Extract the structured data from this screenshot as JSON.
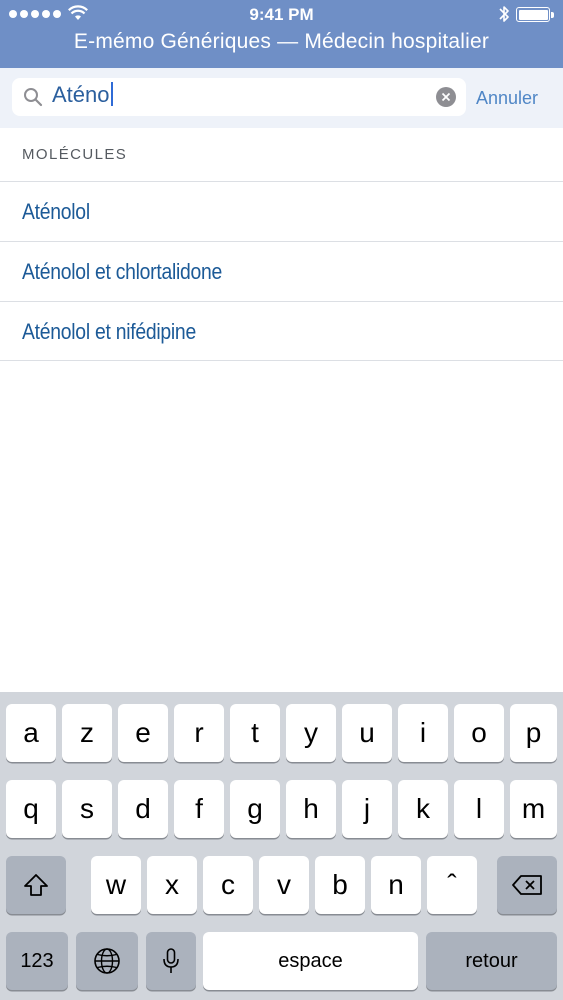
{
  "status_bar": {
    "time": "9:41 PM",
    "signal_icon": "signal-dots-icon",
    "wifi_icon": "wifi-icon",
    "bluetooth_icon": "bluetooth-icon",
    "battery_icon": "battery-icon",
    "battery_level": 1.0
  },
  "header": {
    "title": "E-mémo Génériques — Médecin hospitalier"
  },
  "search": {
    "value": "Aténo",
    "search_icon": "magnifier-icon",
    "clear_icon": "clear-x-icon",
    "cancel_label": "Annuler"
  },
  "results": {
    "section_title": "MOLÉCULES",
    "items": [
      {
        "label": "Aténolol"
      },
      {
        "label": "Aténolol et chlortalidone"
      },
      {
        "label": "Aténolol et nifédipine"
      }
    ]
  },
  "keyboard": {
    "row1": [
      "a",
      "z",
      "e",
      "r",
      "t",
      "y",
      "u",
      "i",
      "o",
      "p"
    ],
    "row2": [
      "q",
      "s",
      "d",
      "f",
      "g",
      "h",
      "j",
      "k",
      "l",
      "m"
    ],
    "row3": [
      "w",
      "x",
      "c",
      "v",
      "b",
      "n",
      "ˆ"
    ],
    "shift_icon": "shift-icon",
    "backspace_icon": "backspace-icon",
    "numbers_label": "123",
    "globe_icon": "globe-icon",
    "mic_icon": "microphone-icon",
    "space_label": "espace",
    "return_label": "retour"
  },
  "colors": {
    "header_bg": "#6f8fc6",
    "accent": "#4f86c6",
    "result_text": "#1c5a97"
  }
}
